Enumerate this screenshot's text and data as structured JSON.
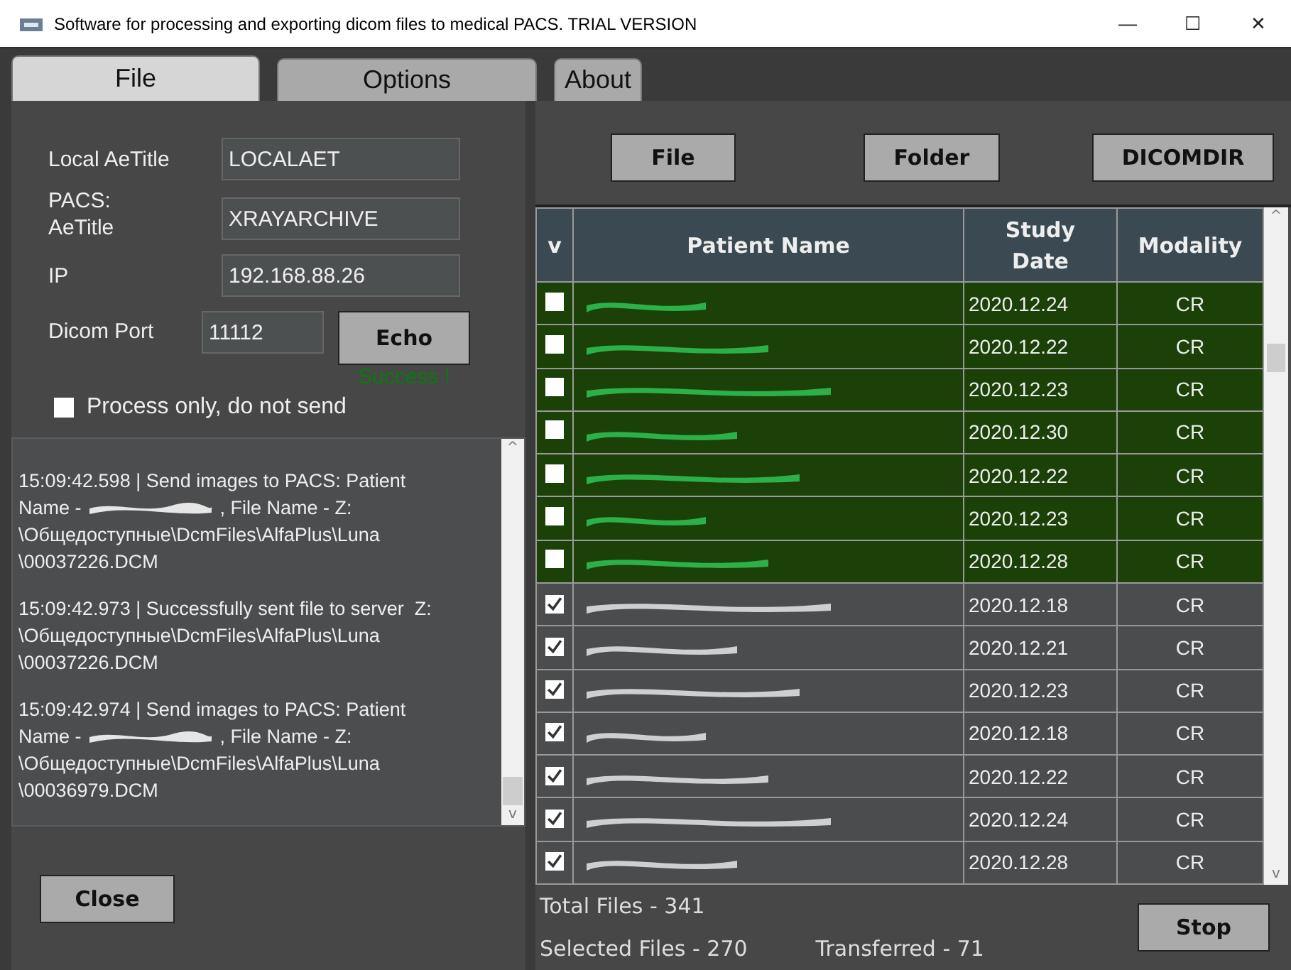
{
  "window": {
    "title": "Software for processing and exporting dicom files to medical PACS. TRIAL VERSION",
    "controls": [
      "—",
      "☐",
      "✕"
    ]
  },
  "tabs": [
    {
      "label": "File",
      "selected": true
    },
    {
      "label": "Options",
      "selected": false
    },
    {
      "label": "About",
      "selected": false
    }
  ],
  "settings": {
    "local_aetitle_label": "Local AeTitle",
    "local_aetitle": "LOCALAET",
    "pacs_label": "PACS:",
    "aetitle_label": "AeTitle",
    "aetitle": "XRAYARCHIVE",
    "ip_label": "IP",
    "ip": "192.168.88.26",
    "port_label": "Dicom Port",
    "port": "11112",
    "echo_button": "Echo",
    "echo_status": "Success !",
    "process_only": {
      "label": "Process only, do not send",
      "checked": false
    }
  },
  "log": [
    {
      "lines": [
        {
          "text": "15:09:42.598 | Send images to PACS: Patient"
        },
        {
          "text": "Name - ",
          "redacted": true,
          "after": " , File Name - Z:"
        },
        {
          "text": "\\Общедоступные\\DcmFiles\\AlfaPlus\\Luna"
        },
        {
          "text": "\\00037226.DCM"
        }
      ]
    },
    {
      "lines": [
        {
          "text": "15:09:42.973 | Successfully sent file to server  Z:"
        },
        {
          "text": "\\Общедоступные\\DcmFiles\\AlfaPlus\\Luna"
        },
        {
          "text": "\\00037226.DCM"
        }
      ]
    },
    {
      "lines": [
        {
          "text": "15:09:42.974 | Send images to PACS: Patient"
        },
        {
          "text": "Name - ",
          "redacted": true,
          "after": " , File Name - Z:"
        },
        {
          "text": "\\Общедоступные\\DcmFiles\\AlfaPlus\\Luna"
        },
        {
          "text": "\\00036979.DCM"
        }
      ]
    }
  ],
  "log_scroll": {
    "up": "^",
    "down": "v"
  },
  "table_scroll": {
    "up": "^",
    "down": "v"
  },
  "source_buttons": [
    "File",
    "Folder",
    "DICOMDIR"
  ],
  "table": {
    "columns": [
      "v",
      "Patient Name",
      "Study Date",
      "Modality"
    ],
    "rows": [
      {
        "checked": false,
        "sent": true,
        "date": "2020.12.24",
        "modality": "CR"
      },
      {
        "checked": false,
        "sent": true,
        "date": "2020.12.22",
        "modality": "CR"
      },
      {
        "checked": false,
        "sent": true,
        "date": "2020.12.23",
        "modality": "CR"
      },
      {
        "checked": false,
        "sent": true,
        "date": "2020.12.30",
        "modality": "CR"
      },
      {
        "checked": false,
        "sent": true,
        "date": "2020.12.22",
        "modality": "CR"
      },
      {
        "checked": false,
        "sent": true,
        "date": "2020.12.23",
        "modality": "CR"
      },
      {
        "checked": false,
        "sent": true,
        "date": "2020.12.28",
        "modality": "CR"
      },
      {
        "checked": true,
        "sent": false,
        "date": "2020.12.18",
        "modality": "CR"
      },
      {
        "checked": true,
        "sent": false,
        "date": "2020.12.21",
        "modality": "CR"
      },
      {
        "checked": true,
        "sent": false,
        "date": "2020.12.23",
        "modality": "CR"
      },
      {
        "checked": true,
        "sent": false,
        "date": "2020.12.18",
        "modality": "CR"
      },
      {
        "checked": true,
        "sent": false,
        "date": "2020.12.22",
        "modality": "CR"
      },
      {
        "checked": true,
        "sent": false,
        "date": "2020.12.24",
        "modality": "CR"
      },
      {
        "checked": true,
        "sent": false,
        "date": "2020.12.28",
        "modality": "CR"
      }
    ]
  },
  "close_button": "Close",
  "stop_button": "Stop",
  "status": {
    "total": "Total Files - 341",
    "selected": "Selected Files - 270",
    "transferred": "Transferred - 71"
  }
}
